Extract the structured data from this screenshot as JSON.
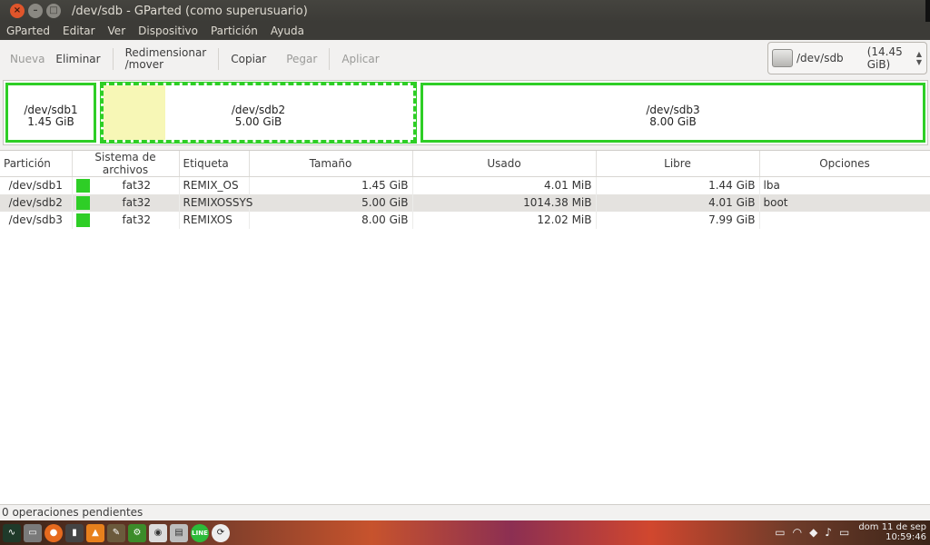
{
  "window": {
    "title": "/dev/sdb - GParted (como superusuario)"
  },
  "menu": [
    "GParted",
    "Editar",
    "Ver",
    "Dispositivo",
    "Partición",
    "Ayuda"
  ],
  "toolbar": {
    "new": "Nueva",
    "delete": "Eliminar",
    "resize_line1": "Redimensionar",
    "resize_line2": "/mover",
    "copy": "Copiar",
    "paste": "Pegar",
    "apply": "Aplicar"
  },
  "device": {
    "name": "/dev/sdb",
    "size": "(14.45 GiB)"
  },
  "diskmap": [
    {
      "name": "/dev/sdb1",
      "size": "1.45 GiB"
    },
    {
      "name": "/dev/sdb2",
      "size": "5.00 GiB",
      "used_fraction": 0.2
    },
    {
      "name": "/dev/sdb3",
      "size": "8.00 GiB"
    }
  ],
  "table": {
    "columns": [
      "Partición",
      "Sistema de archivos",
      "Etiqueta",
      "Tamaño",
      "Usado",
      "Libre",
      "Opciones"
    ],
    "rows": [
      {
        "partition": "/dev/sdb1",
        "fs": "fat32",
        "label": "REMIX_OS",
        "size": "1.45 GiB",
        "used": "4.01 MiB",
        "free": "1.44 GiB",
        "flags": "lba"
      },
      {
        "partition": "/dev/sdb2",
        "fs": "fat32",
        "label": "REMIXOSSYS",
        "size": "5.00 GiB",
        "used": "1014.38 MiB",
        "free": "4.01 GiB",
        "flags": "boot"
      },
      {
        "partition": "/dev/sdb3",
        "fs": "fat32",
        "label": "REMIXOS",
        "size": "8.00 GiB",
        "used": "12.02 MiB",
        "free": "7.99 GiB",
        "flags": ""
      }
    ]
  },
  "status": {
    "pending": "0 operaciones pendientes"
  },
  "taskbar": {
    "clock_date": "dom 11 de sep",
    "clock_time": "10:59:46",
    "line_badge": "LINE"
  },
  "colors": {
    "fat32": "#2ece26",
    "used": "#f7f7b6"
  }
}
